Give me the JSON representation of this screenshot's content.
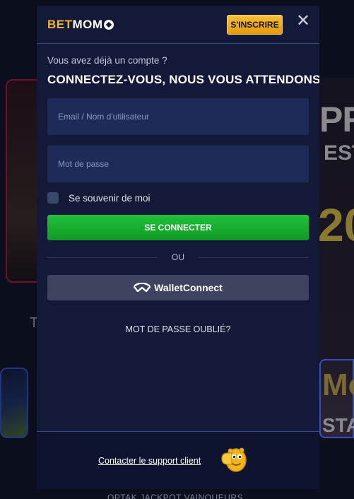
{
  "background": {
    "right_text_top": "PR",
    "right_text_est": "EST",
    "right_text_year": "20",
    "right_text_mo": "Mo",
    "right_text_sta": "STA",
    "left_letter": "T",
    "footer_text": "OPTAK JACKPOT VAINQUEURS"
  },
  "modal": {
    "logo": {
      "part1": "BET",
      "part2": "MOM"
    },
    "signup_label": "S'INSCRIRE",
    "close_symbol": "✕",
    "subtitle": "Vous avez déjà un compte ?",
    "title": "CONNECTEZ-VOUS, NOUS VOUS ATTENDONS",
    "email_placeholder": "Email / Nom d'utilisateur",
    "password_placeholder": "Mot de passe",
    "remember_label": "Se souvenir de moi",
    "login_label": "SE CONNECTER",
    "divider_label": "OU",
    "wallet_label": "WalletConnect",
    "forgot_label": "MOT DE PASSE OUBLIÉ?",
    "support_label": "Contacter le support client"
  },
  "colors": {
    "modal_bg": "#131a37",
    "input_bg": "#1e2b59",
    "brand_yellow": "#f5b623",
    "login_green": "#1aae31",
    "wallet_bg": "#3c445f"
  },
  "icons": {
    "close": "close-icon",
    "wallet": "walletconnect-icon",
    "mascot": "support-mascot-icon",
    "logo_ball": "soccer-ball-icon"
  }
}
